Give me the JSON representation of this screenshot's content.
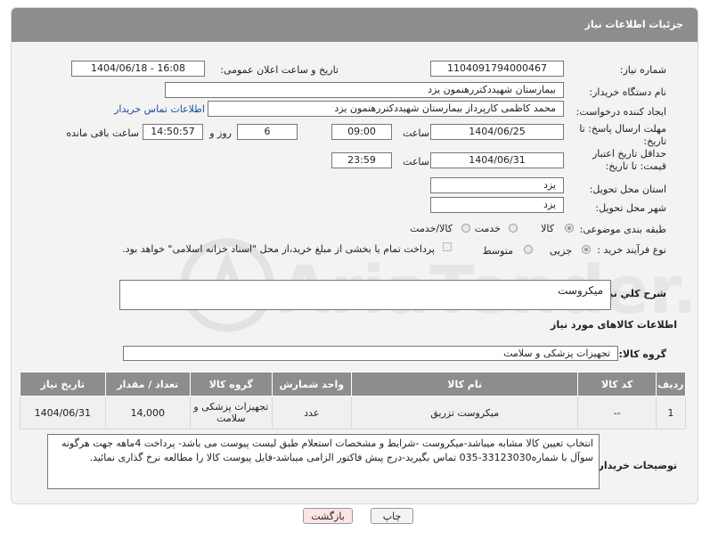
{
  "header": {
    "title": "جزئیات اطلاعات نیاز"
  },
  "labels": {
    "need_number": "شماره نیاز:",
    "announce_datetime": "تاریخ و ساعت اعلان عمومی:",
    "buyer_org": "نام دستگاه خریدار:",
    "requester": "ایجاد کننده درخواست:",
    "deadline": "مهلت ارسال پاسخ: تا تاریخ:",
    "time": "ساعت",
    "day_and": "روز و",
    "remaining": "ساعت باقی مانده",
    "min_validity": "حداقل تاریخ اعتبار قیمت: تا تاریخ:",
    "province": "استان محل تحویل:",
    "city": "شهر محل تحویل:",
    "category": "طبقه بندی موضوعی:",
    "process_type": "نوع فرآیند خرید :",
    "general_desc": "شرح کلي نياز:",
    "goods_info": "اطلاعات کالاهای مورد نیاز",
    "goods_group": "گروه کالا:",
    "buyer_notes": "توضیحات خریدار:"
  },
  "fields": {
    "need_number": "1104091794000467",
    "announce_datetime": "1404/06/18 - 16:08",
    "buyer_org": "بیمارستان شهیددکتررهنمون یزد",
    "requester": "محمد کاظمی کارپرداز بیمارستان شهیددکتررهنمون یزد",
    "buyer_contact_link": "اطلاعات تماس خریدار",
    "deadline_date": "1404/06/25",
    "deadline_time": "09:00",
    "days": "6",
    "remaining_time": "14:50:57",
    "validity_date": "1404/06/31",
    "validity_time": "23:59",
    "province": "یزد",
    "city": "یزد",
    "general_desc": "میکروست",
    "goods_group": "تجهیزات پزشکی و سلامت",
    "buyer_notes": "انتخاب تعیین کالا مشابه میباشد-میکروست -شرایط و مشخصات استعلام طبق لیست پیوست می باشد- پرداخت 4ماهه جهت هرگونه سوآل با شماره33123030-035 تماس بگیرید-درج پیش فاکتور الزامی میباشد-فایل پیوست کالا را مطالعه نرخ گذاری نمائید."
  },
  "category_options": {
    "goods": "کالا",
    "service": "خدمت",
    "goods_service": "کالا/خدمت",
    "selected": "کالا"
  },
  "process_options": {
    "minor": "جزیی",
    "medium": "متوسط",
    "treasury_note": "پرداخت تمام یا بخشی از مبلغ خرید،از محل \"اسناد خزانه اسلامی\" خواهد بود.",
    "selected": "جزیی"
  },
  "table": {
    "headers": [
      "ردیف",
      "کد کالا",
      "نام کالا",
      "واحد شمارش",
      "گروه کالا",
      "تعداد / مقدار",
      "تاریخ نیاز"
    ],
    "rows": [
      [
        "1",
        "--",
        "میکروست تزریق",
        "عدد",
        "تجهیزات پزشکی و سلامت",
        "14,000",
        "1404/06/31"
      ]
    ]
  },
  "buttons": {
    "print": "چاپ",
    "back": "بازگشت"
  },
  "watermark": {
    "text": "AriaTender.net"
  },
  "colors": {
    "header_bg": "#8d8d8d",
    "link": "#1a4f9a",
    "back_button_bg": "#fde4e4"
  }
}
